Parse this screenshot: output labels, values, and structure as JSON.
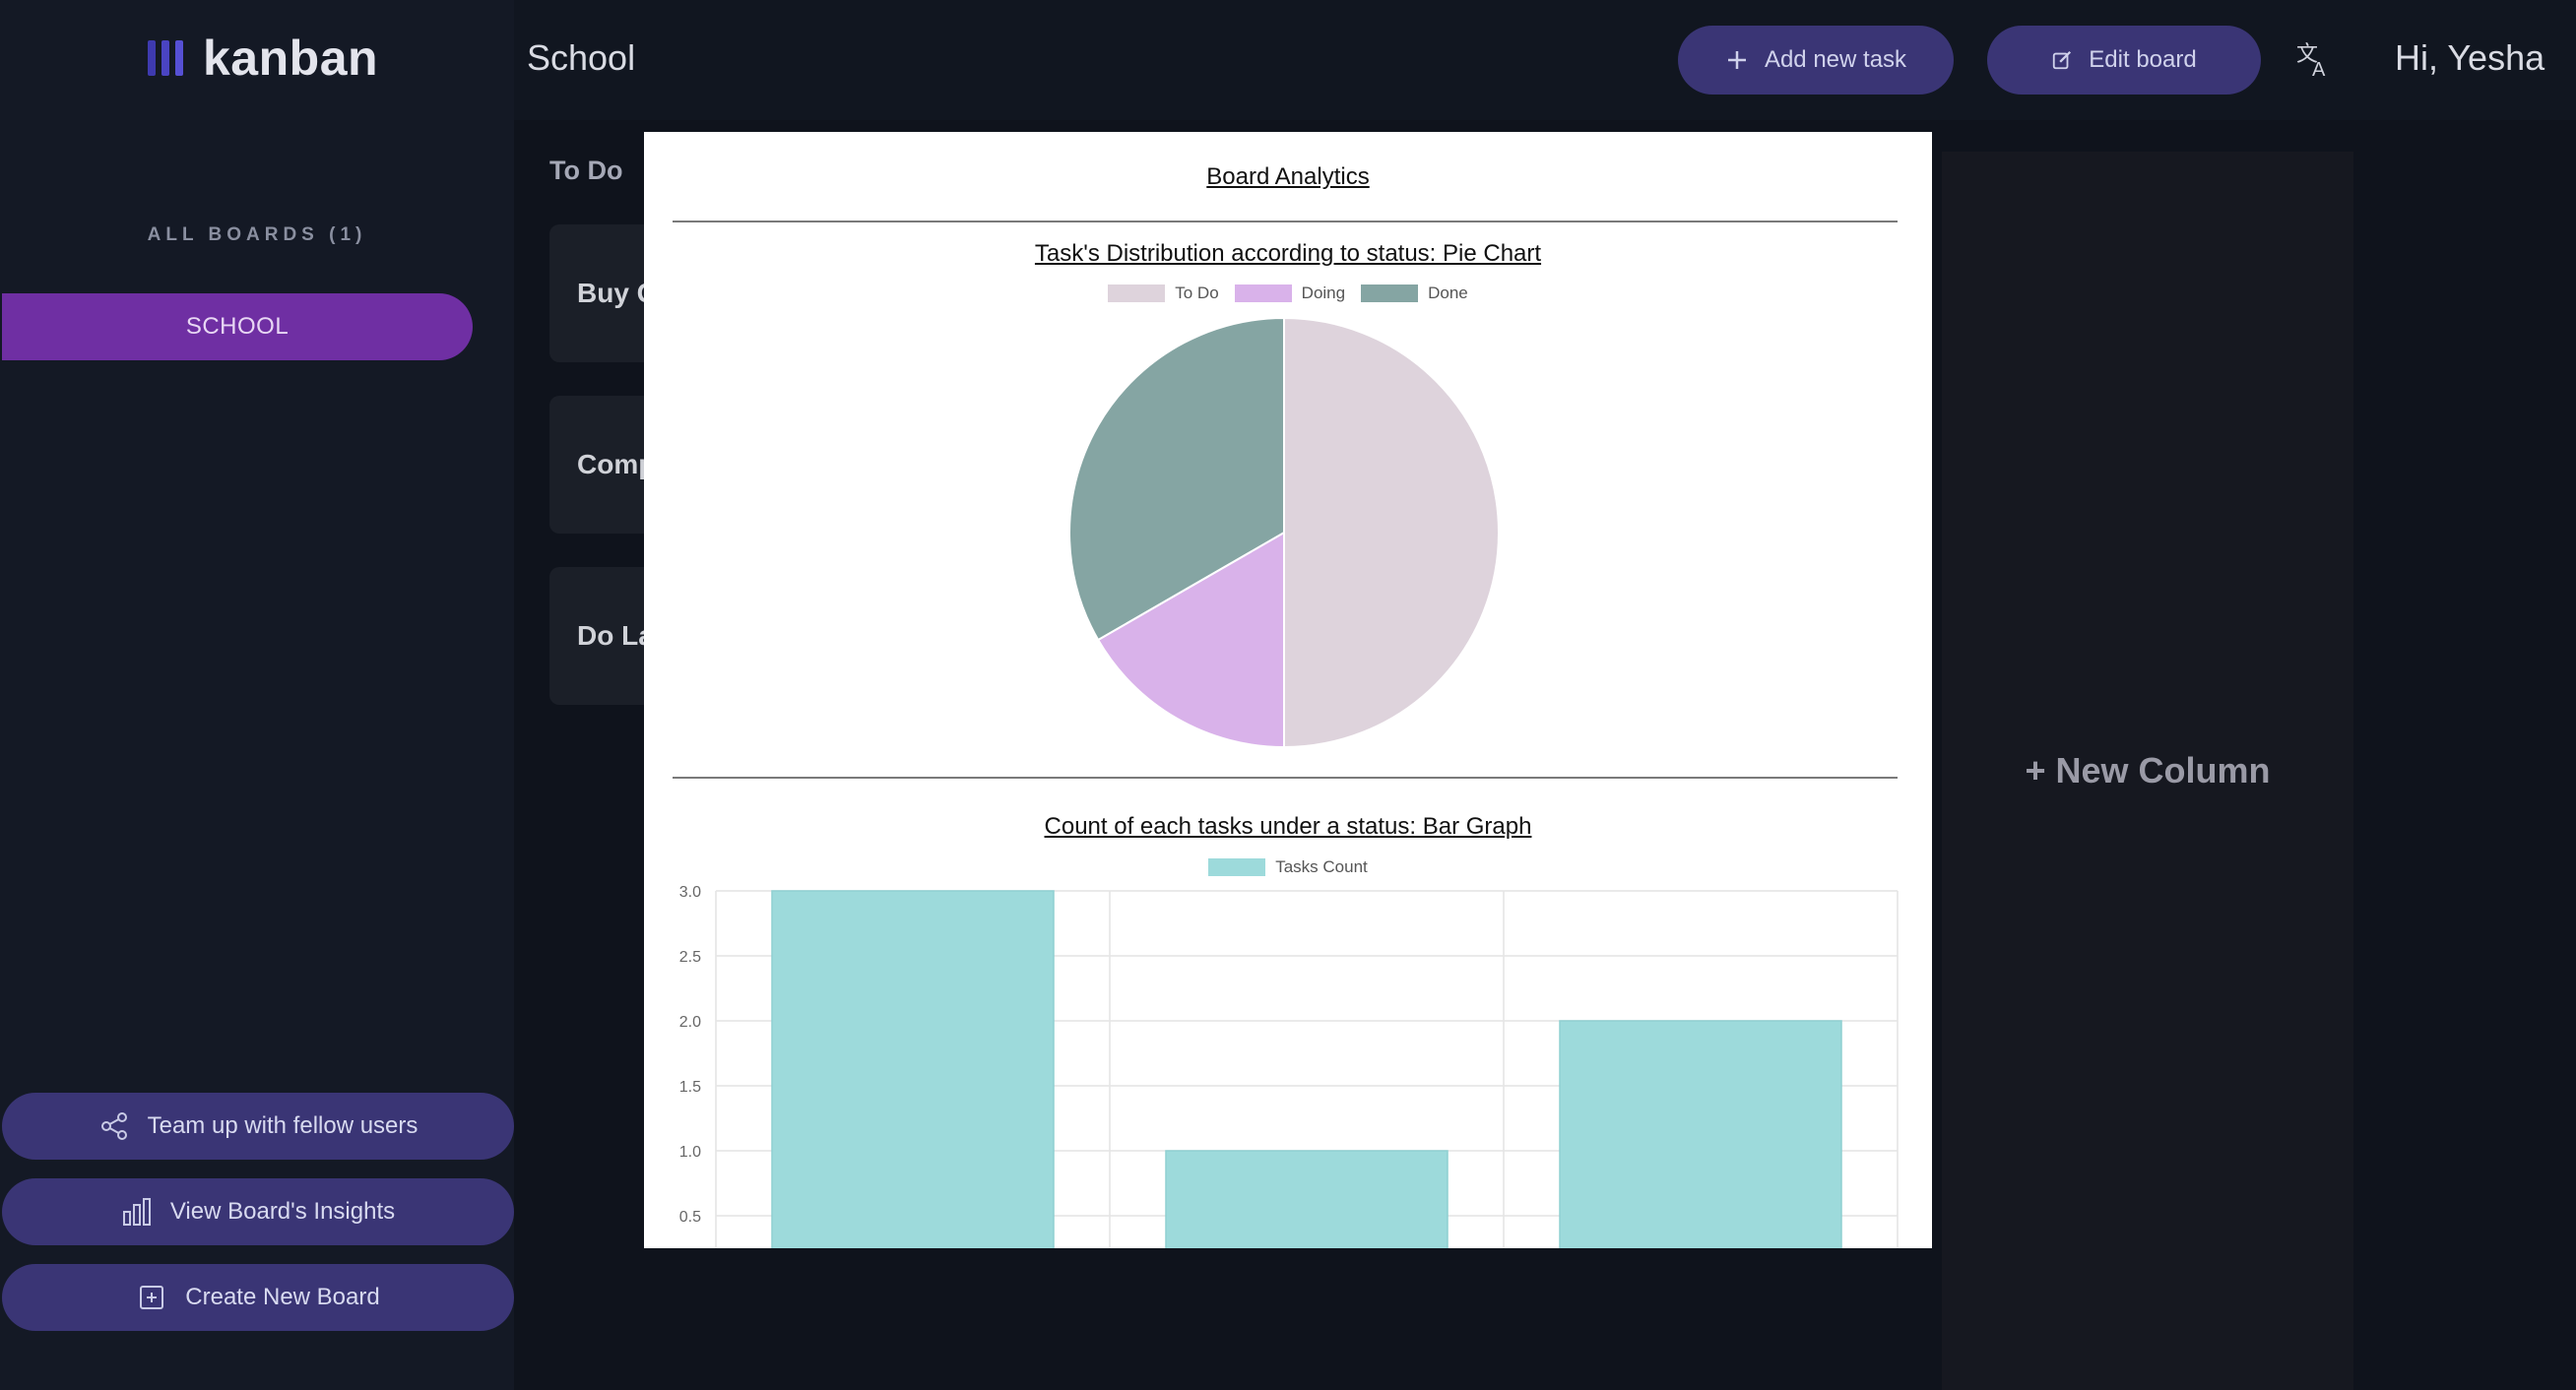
{
  "sidebar": {
    "app_name": "kanban",
    "logo_colors": [
      "#3e3ab0",
      "#4a44c2",
      "#5650d4"
    ],
    "boards_heading": "ALL BOARDS (1)",
    "boards": [
      {
        "label": "SCHOOL"
      }
    ],
    "team_up_label": "Team up with fellow users",
    "insights_label": "View Board's Insights",
    "create_board_label": "Create New Board"
  },
  "header": {
    "board_title": "School",
    "add_task_label": "Add new task",
    "edit_board_label": "Edit board",
    "greeting": "Hi, Yesha"
  },
  "board": {
    "columns": [
      {
        "title": "To Do",
        "tasks": [
          "Buy G",
          "Comp",
          "Do La"
        ]
      }
    ],
    "new_column_label": "+ New Column"
  },
  "modal": {
    "title": "Board Analytics",
    "pie_title": "Task's Distribution according to status: Pie Chart",
    "bar_title": "Count of each tasks under a status: Bar Graph"
  },
  "chart_data": [
    {
      "type": "pie",
      "title": "Task's Distribution according to status: Pie Chart",
      "legend_position": "top",
      "categories": [
        "To Do",
        "Doing",
        "Done"
      ],
      "values": [
        3,
        1,
        2
      ],
      "colors": [
        "#ded3dc",
        "#d9b2ea",
        "#85a5a3"
      ]
    },
    {
      "type": "bar",
      "title": "Count of each tasks under a status: Bar Graph",
      "legend_position": "top",
      "series": [
        {
          "name": "Tasks Count",
          "values": [
            3,
            1,
            2
          ],
          "color": "#9ddadb"
        }
      ],
      "ylim": [
        0,
        3
      ],
      "yticks": [
        "3.0",
        "2.5",
        "2.0",
        "1.5",
        "1.0",
        "0.5"
      ],
      "grid": true
    }
  ]
}
